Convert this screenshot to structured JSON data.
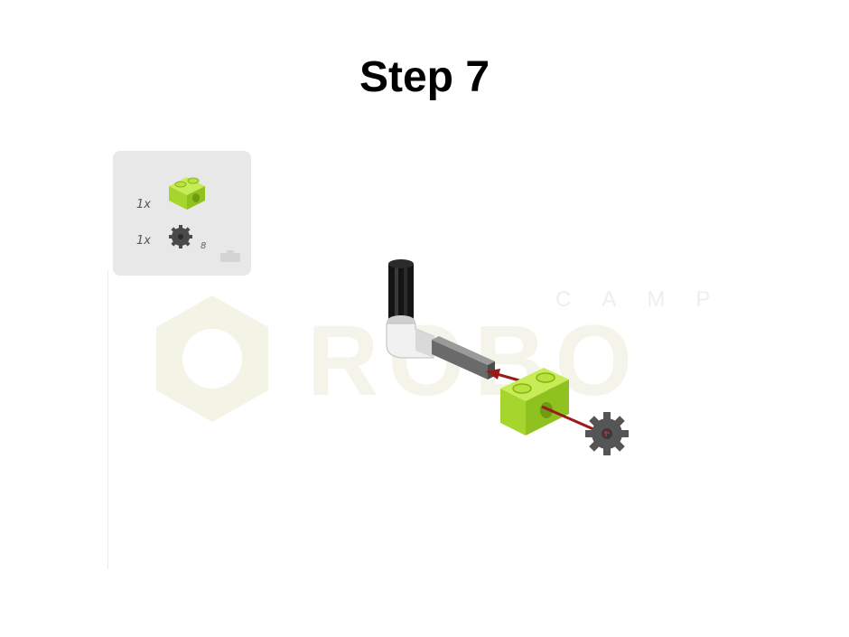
{
  "header": {
    "title": "Step 7"
  },
  "parts_list": {
    "items": [
      {
        "quantity": "1x",
        "name": "lime-technic-brick-1x2-icon",
        "color": "#a6d52e"
      },
      {
        "quantity": "1x",
        "name": "dark-gray-gear-8-tooth-icon",
        "color": "#4a4a4a",
        "size_label": "8"
      }
    ]
  },
  "watermark": {
    "text_top": "CAMP",
    "text_main": "ROBO",
    "color": "#f2f2e4"
  },
  "colors": {
    "lime": "#a6d52e",
    "arrow": "#9b1b1b",
    "axle": "#111111",
    "connector": "#e6e6e6",
    "gray_axle": "#6a6a6a"
  }
}
